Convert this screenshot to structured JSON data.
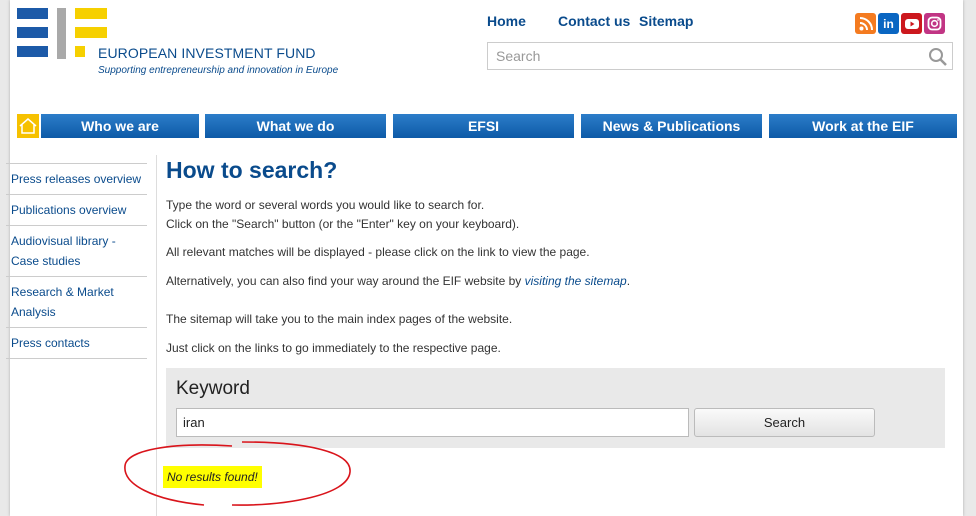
{
  "header": {
    "brand": "EUROPEAN INVESTMENT FUND",
    "tagline": "Supporting entrepreneurship and innovation in Europe",
    "links": [
      "Home",
      "Contact us",
      "Sitemap"
    ],
    "search_placeholder": "Search",
    "social": [
      "rss-icon",
      "linkedin-icon",
      "youtube-icon",
      "instagram-icon"
    ]
  },
  "nav": {
    "items": [
      "Who we are",
      "What we do",
      "EFSI",
      "News & Publications",
      "Work at the EIF"
    ]
  },
  "sidebar": {
    "items": [
      "Press releases overview",
      "Publications overview",
      "Audiovisual library - Case studies",
      "Research & Market Analysis",
      "Press contacts"
    ]
  },
  "content": {
    "title": "How to search?",
    "p1_line1": "Type the word or several words you would like to search for.",
    "p1_line2": "Click on the \"Search\" button (or the \"Enter\" key on your keyboard).",
    "p2": "All relevant matches will be displayed - please click on the link to view the page.",
    "p3_prefix": "Alternatively, you can also find your way around the EIF website by ",
    "p3_link": "visiting the sitemap",
    "p3_suffix": ".",
    "p4": "The sitemap will take you to the main index pages of the website.",
    "p5": "Just click on the links to go immediately to the respective page."
  },
  "keyword": {
    "label": "Keyword",
    "value": "iran",
    "button": "Search"
  },
  "result": "No results found!",
  "colors": {
    "brand_blue": "#0a4b8c",
    "accent_yellow": "#f6c100",
    "nav_blue": "#1565b5",
    "highlight": "#ffff00",
    "annotation_red": "#d9141b"
  }
}
